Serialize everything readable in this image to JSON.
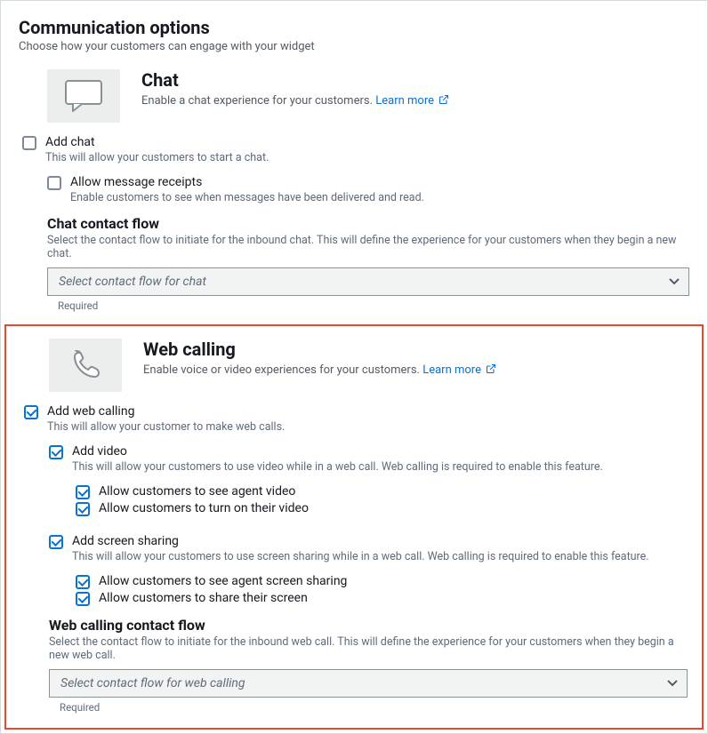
{
  "header": {
    "title": "Communication options",
    "subtitle": "Choose how your customers can engage with your widget"
  },
  "chat": {
    "title": "Chat",
    "desc": "Enable a chat experience for your customers.",
    "learn_more": "Learn more",
    "add_label": "Add chat",
    "add_sub": "This will allow your customers to start a chat.",
    "receipts_label": "Allow message receipts",
    "receipts_sub": "Enable customers to see when messages have been delivered and read.",
    "flow_title": "Chat contact flow",
    "flow_sub": "Select the contact flow to initiate for the inbound chat. This will define the experience for your customers when they begin a new chat.",
    "flow_placeholder": "Select contact flow for chat",
    "required": "Required"
  },
  "web": {
    "title": "Web calling",
    "desc": "Enable voice or video experiences for your customers.",
    "learn_more": "Learn more",
    "add_label": "Add web calling",
    "add_sub": "This will allow your customer to make web calls.",
    "video_label": "Add video",
    "video_sub": "This will allow your customers to use video while in a web call. Web calling is required to enable this feature.",
    "video_opt1": "Allow customers to see agent video",
    "video_opt2": "Allow customers to turn on their video",
    "screen_label": "Add screen sharing",
    "screen_sub": "This will allow your customers to use screen sharing while in a web call. Web calling is required to enable this feature.",
    "screen_opt1": "Allow customers to see agent screen sharing",
    "screen_opt2": "Allow customers to share their screen",
    "flow_title": "Web calling contact flow",
    "flow_sub": "Select the contact flow to initiate for the inbound web call. This will define the experience for your customers when they begin a new web call.",
    "flow_placeholder": "Select contact flow for web calling",
    "required": "Required"
  }
}
